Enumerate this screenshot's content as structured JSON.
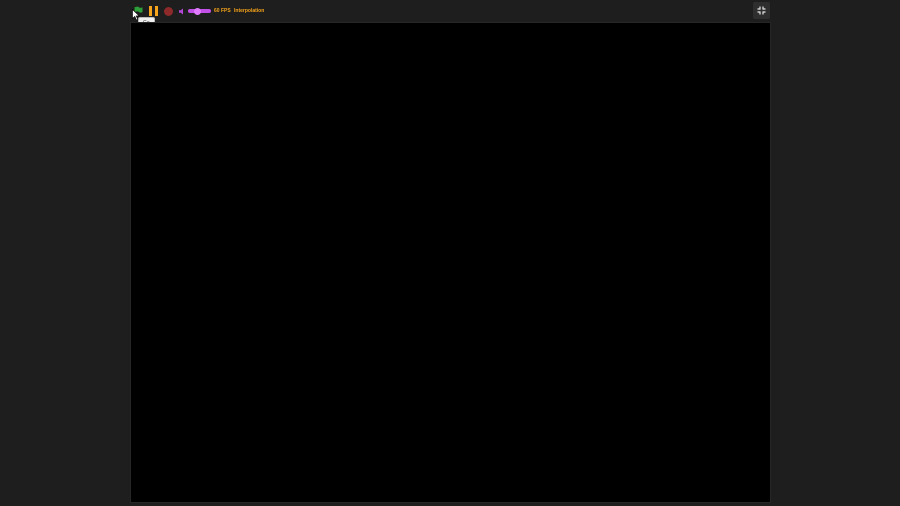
{
  "toolbar": {
    "go_icon": "green-flag-icon",
    "pause_icon": "pause-icon",
    "stop_icon": "stop-icon",
    "volume_icon": "speaker-icon",
    "volume_level": 0.35,
    "fps_label": "60 FPS",
    "interpolation_label": "Interpolation",
    "fullscreen_icon": "fullscreen-icon"
  },
  "tooltip": {
    "text": "Go"
  },
  "colors": {
    "accent": "#f5a31a",
    "volume": "#c24fe6",
    "stop": "#8e2a2a",
    "flag": "#2e9e3a",
    "stage": "#000000",
    "background": "#1e1e1e"
  }
}
